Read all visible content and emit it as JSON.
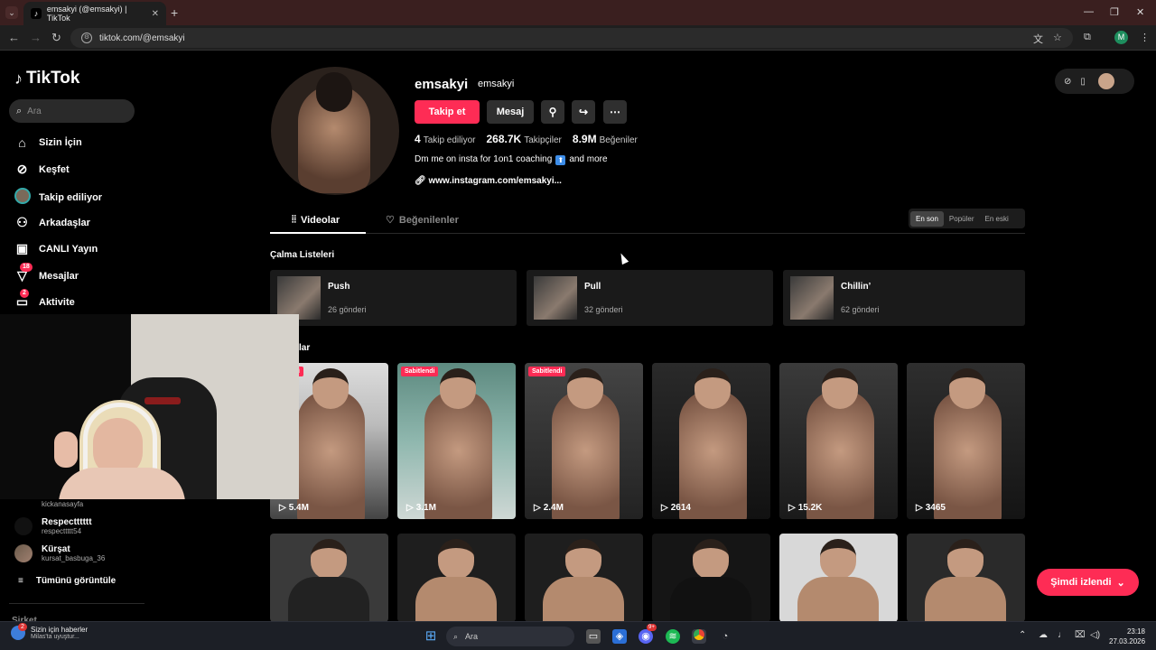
{
  "browser": {
    "tab_title": "emsakyi (@emsakyi) | TikTok",
    "url": "tiktok.com/@emsakyi",
    "profile_initial": "M"
  },
  "sidebar": {
    "logo": "TikTok",
    "search_placeholder": "Ara",
    "items": [
      {
        "label": "Sizin İçin",
        "icon": "home-icon"
      },
      {
        "label": "Keşfet",
        "icon": "compass-icon"
      },
      {
        "label": "Takip ediliyor",
        "icon": "following-avatar-icon"
      },
      {
        "label": "Arkadaşlar",
        "icon": "friends-icon"
      },
      {
        "label": "CANLI Yayın",
        "icon": "live-icon"
      },
      {
        "label": "Mesajlar",
        "icon": "messages-icon",
        "badge": "18"
      },
      {
        "label": "Aktivite",
        "icon": "activity-icon",
        "badge": "2"
      }
    ],
    "following_accounts": [
      {
        "name": "",
        "handle": "kickanasayfa"
      },
      {
        "name": "Respectttttt",
        "handle": "respecttttt54"
      },
      {
        "name": "Kürşat",
        "handle": "kursat_basbuga_36"
      }
    ],
    "see_all": "Tümünü görüntüle",
    "footer": "Şirket"
  },
  "profile": {
    "username": "emsakyi",
    "nickname": "emsakyi",
    "follow_label": "Takip et",
    "message_label": "Mesaj",
    "following_count": "4",
    "following_label": "Takip ediliyor",
    "followers_count": "268.7K",
    "followers_label": "Takipçiler",
    "likes_count": "8.9M",
    "likes_label": "Beğeniler",
    "bio_before": "Dm me on insta for 1on1 coaching",
    "bio_emoji": "⬆",
    "bio_after": "and more",
    "link": "www.instagram.com/emsakyi..."
  },
  "tabs": {
    "videos": "Videolar",
    "liked": "Beğenilenler"
  },
  "sort": {
    "latest": "En son",
    "popular": "Popüler",
    "oldest": "En eski"
  },
  "playlists": {
    "title": "Çalma Listeleri",
    "items": [
      {
        "name": "Push",
        "count": "26 gönderi"
      },
      {
        "name": "Pull",
        "count": "32 gönderi"
      },
      {
        "name": "Chillin’",
        "count": "62 gönderi"
      }
    ]
  },
  "videos_section_title": "lar",
  "videos": [
    {
      "views": "5.4M",
      "pinned": "bitlendi"
    },
    {
      "views": "3.1M",
      "pinned": "Sabitlendi"
    },
    {
      "views": "2.4M",
      "pinned": "Sabitlendi"
    },
    {
      "views": "2614",
      "pinned": ""
    },
    {
      "views": "15.2K",
      "pinned": ""
    },
    {
      "views": "3465",
      "pinned": ""
    }
  ],
  "now_watching": "Şimdi izlendi",
  "taskbar": {
    "news_title": "Sizin için haberler",
    "news_sub": "Milas'ta uyuştur...",
    "news_badge": "2",
    "search_label": "Ara",
    "discord_badge": "9+",
    "time": "23:18",
    "date": "27.03.2026"
  },
  "colors": {
    "accent": "#fe2c55",
    "tab_strip": "#3a1f1f",
    "background": "#000000"
  }
}
